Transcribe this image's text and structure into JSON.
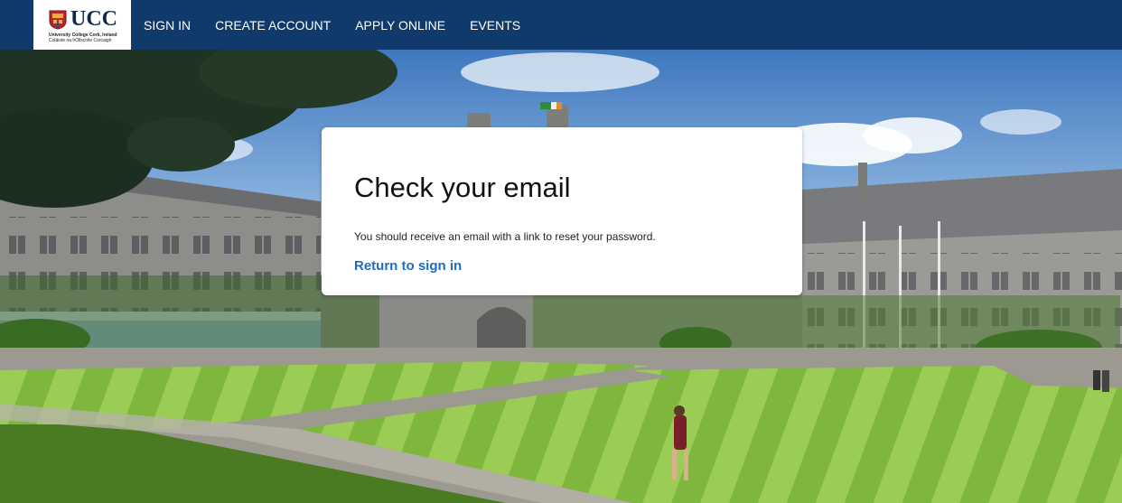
{
  "brand": {
    "logo_text": "UCC",
    "logo_subline_1": "University College Cork, Ireland",
    "logo_subline_2": "Coláiste na hOllscoile Corcaigh",
    "nav_color": "#0f3a6b"
  },
  "nav": {
    "items": [
      {
        "label": "SIGN IN"
      },
      {
        "label": "CREATE ACCOUNT"
      },
      {
        "label": "APPLY ONLINE"
      },
      {
        "label": "EVENTS"
      }
    ]
  },
  "card": {
    "title": "Check your email",
    "message": "You should receive an email with a link to reset your password.",
    "link_label": "Return to sign in",
    "link_color": "#1f6cbf"
  },
  "icons": {
    "crest": "ucc-crest-icon"
  }
}
